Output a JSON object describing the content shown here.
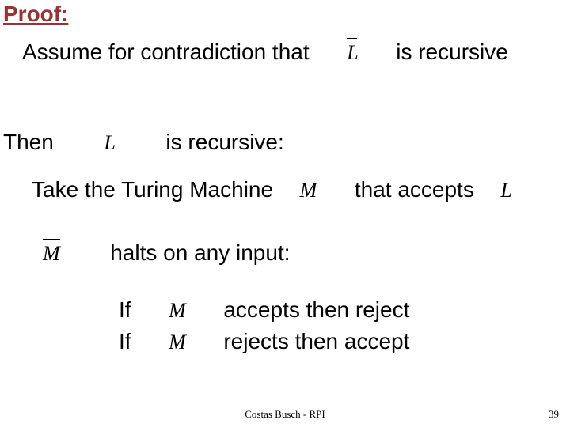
{
  "heading": "Proof:",
  "assume": {
    "before": "Assume for contradiction that",
    "sym": "L",
    "after": "is recursive"
  },
  "then": {
    "before": "Then",
    "sym": "L",
    "after": "is recursive:"
  },
  "take": {
    "before": "Take the Turing Machine",
    "sym1": "M",
    "middle": "that accepts",
    "sym2": "L"
  },
  "halts": {
    "sym": "M",
    "text": "halts on any input:"
  },
  "if1": {
    "if": "If",
    "sym": "M",
    "rest": "accepts then reject"
  },
  "if2": {
    "if": "If",
    "sym": "M",
    "rest": "rejects then accept"
  },
  "footer": "Costas Busch - RPI",
  "page": "39"
}
